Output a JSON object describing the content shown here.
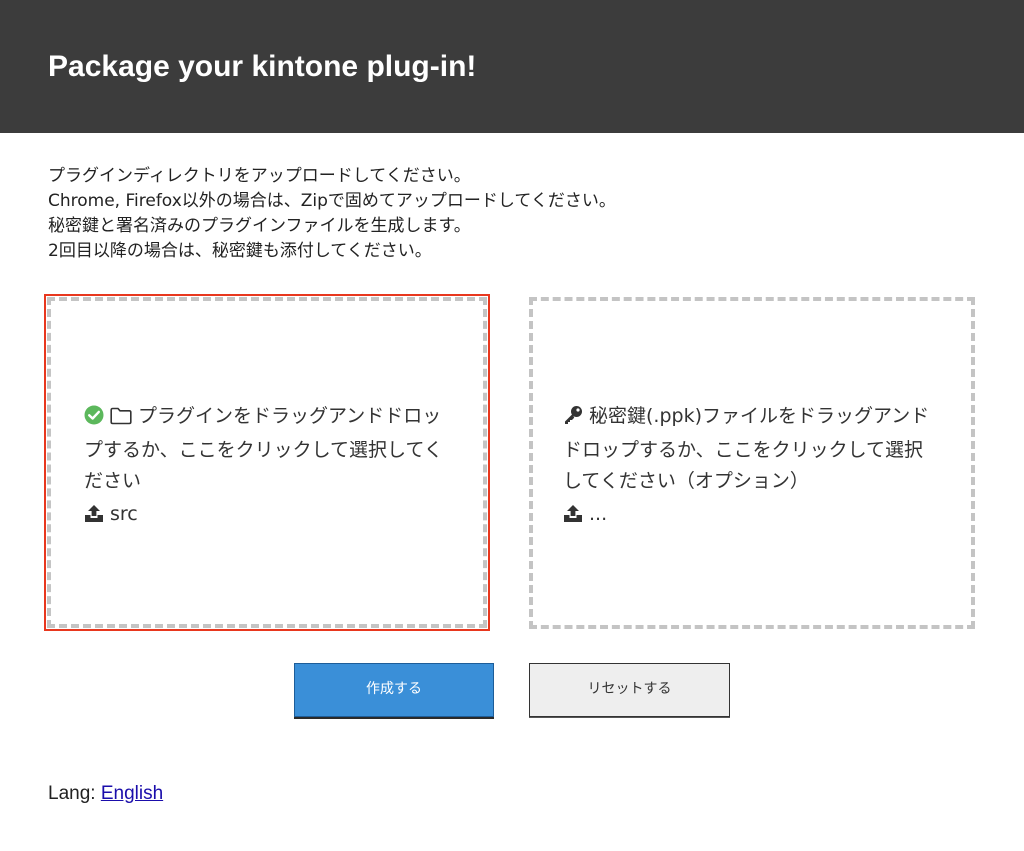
{
  "header": {
    "title": "Package your kintone plug-in!"
  },
  "intro": {
    "lines": [
      "プラグインディレクトリをアップロードしてください。",
      "Chrome, Firefox以外の場合は、Zipで固めてアップロードしてください。",
      "秘密鍵と署名済みのプラグインファイルを生成します。",
      "2回目以降の場合は、秘密鍵も添付してください。"
    ]
  },
  "plugin_drop": {
    "status_icon": "check-circle-icon",
    "folder_icon": "folder-icon",
    "upload_icon": "upload-icon",
    "label": "プラグインをドラッグアンドドロップするか、ここをクリックして選択してください",
    "file_name": "src",
    "selected": true,
    "accent_color": "#e8371e",
    "status_color": "#5cb85c"
  },
  "key_drop": {
    "key_icon": "key-icon",
    "upload_icon": "upload-icon",
    "label": "秘密鍵(.ppk)ファイルをドラッグアンドドロップするか、ここをクリックして選択してください（オプション）",
    "file_name": "..."
  },
  "buttons": {
    "create_label": "作成する",
    "reset_label": "リセットする",
    "primary_color": "#3a8fd8"
  },
  "footer": {
    "lang_label": "Lang:",
    "lang_link": "English"
  }
}
